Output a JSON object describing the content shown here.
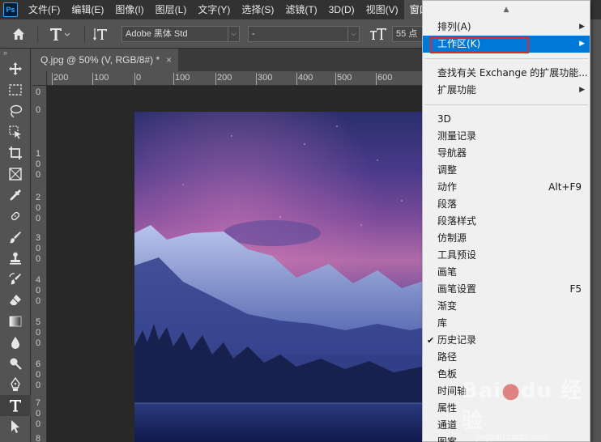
{
  "app": {
    "logo": "Ps"
  },
  "menubar": {
    "items": [
      "文件(F)",
      "编辑(E)",
      "图像(I)",
      "图层(L)",
      "文字(Y)",
      "选择(S)",
      "滤镜(T)",
      "3D(D)",
      "视图(V)",
      "窗口(W)"
    ],
    "active_index": 9
  },
  "options": {
    "font_family": "Adobe 黑体 Std",
    "font_style": "-",
    "font_size": "55 点"
  },
  "toolbar": {
    "header": "»",
    "tools": [
      "move-tool",
      "marquee-tool",
      "lasso-tool",
      "object-select-tool",
      "crop-tool",
      "frame-tool",
      "eyedropper-tool",
      "healing-tool",
      "brush-tool",
      "stamp-tool",
      "history-brush-tool",
      "eraser-tool",
      "gradient-tool",
      "blur-tool",
      "dodge-tool",
      "pen-tool",
      "type-tool",
      "path-select-tool"
    ],
    "active_tool": "type-tool"
  },
  "document": {
    "tab_title": "Q.jpg @ 50% (V, RGB/8#) *",
    "tab_close": "×",
    "ruler_h_labels": [
      "200",
      "100",
      "0",
      "100",
      "200",
      "300",
      "400",
      "500",
      "600"
    ],
    "ruler_v_labels": [
      "0",
      "0",
      "1\n0\n0",
      "2\n0\n0",
      "3\n0\n0",
      "4\n0\n0",
      "5\n0\n0",
      "6\n0\n0",
      "7\n0\n0",
      "8"
    ]
  },
  "window_menu": {
    "scroll_up": "▲",
    "groups": [
      [
        {
          "label": "排列(A)",
          "submenu": true
        },
        {
          "label": "工作区(K)",
          "submenu": true,
          "highlighted": true
        }
      ],
      [
        {
          "label": "查找有关 Exchange 的扩展功能..."
        },
        {
          "label": "扩展功能",
          "submenu": true
        }
      ],
      [
        {
          "label": "3D"
        },
        {
          "label": "测量记录"
        },
        {
          "label": "导航器"
        },
        {
          "label": "调整"
        },
        {
          "label": "动作",
          "shortcut": "Alt+F9"
        },
        {
          "label": "段落"
        },
        {
          "label": "段落样式"
        },
        {
          "label": "仿制源"
        },
        {
          "label": "工具预设"
        },
        {
          "label": "画笔"
        },
        {
          "label": "画笔设置",
          "shortcut": "F5"
        },
        {
          "label": "渐变"
        },
        {
          "label": "库"
        },
        {
          "label": "历史记录",
          "checked": true
        },
        {
          "label": "路径"
        },
        {
          "label": "色板"
        },
        {
          "label": "时间轴"
        },
        {
          "label": "属性"
        },
        {
          "label": "通道"
        },
        {
          "label": "图案"
        }
      ]
    ]
  },
  "watermark": {
    "logo_a": "Bai",
    "logo_b": "du",
    "tail": "经验",
    "url": "jingyan.baidu.com"
  },
  "colors": {
    "menu_highlight": "#0078d7",
    "annotation_box": "#e02828",
    "ui_dark": "#323232",
    "ui_mid": "#535353"
  }
}
